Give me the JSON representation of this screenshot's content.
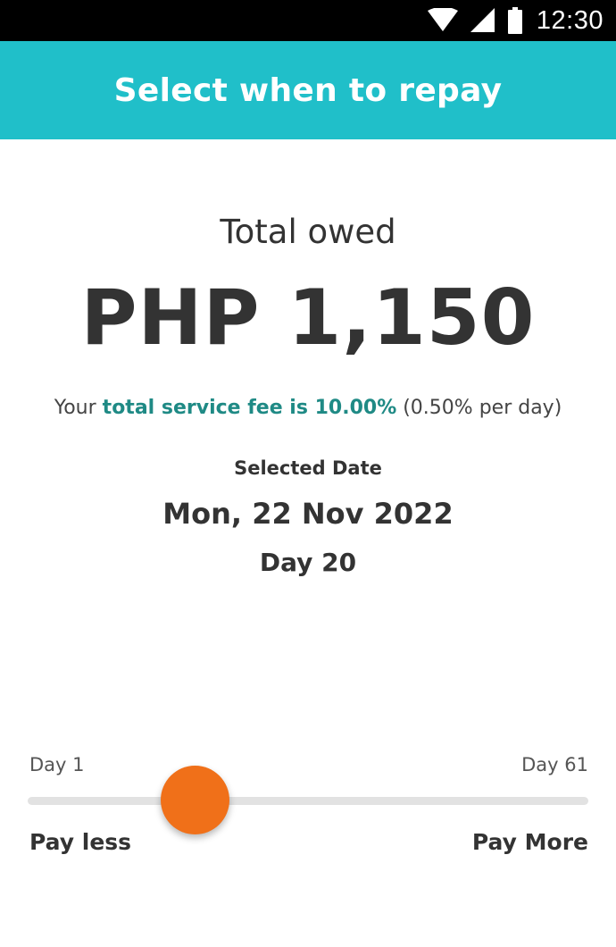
{
  "status_bar": {
    "time": "12:30",
    "icons": [
      "wifi-icon",
      "signal-icon",
      "battery-icon"
    ]
  },
  "header": {
    "title": "Select when to repay"
  },
  "summary": {
    "total_label": "Total owed",
    "total_amount": "PHP 1,150",
    "fee_prefix": "Your ",
    "fee_highlight": "total service fee is 10.00%",
    "fee_suffix": " (0.50% per day)",
    "selected_date_label": "Selected Date",
    "selected_date": "Mon, 22 Nov 2022",
    "selected_day": "Day 20"
  },
  "slider": {
    "min_label": "Day 1",
    "max_label": "Day 61",
    "min_value": 1,
    "max_value": 61,
    "current_value": 20,
    "left_caption": "Pay less",
    "right_caption": "Pay More"
  },
  "colors": {
    "accent": "#20bfc9",
    "fee_highlight": "#1f8a85",
    "slider_thumb": "#f07019",
    "slider_track": "#e2e2e2",
    "text": "#333333"
  }
}
